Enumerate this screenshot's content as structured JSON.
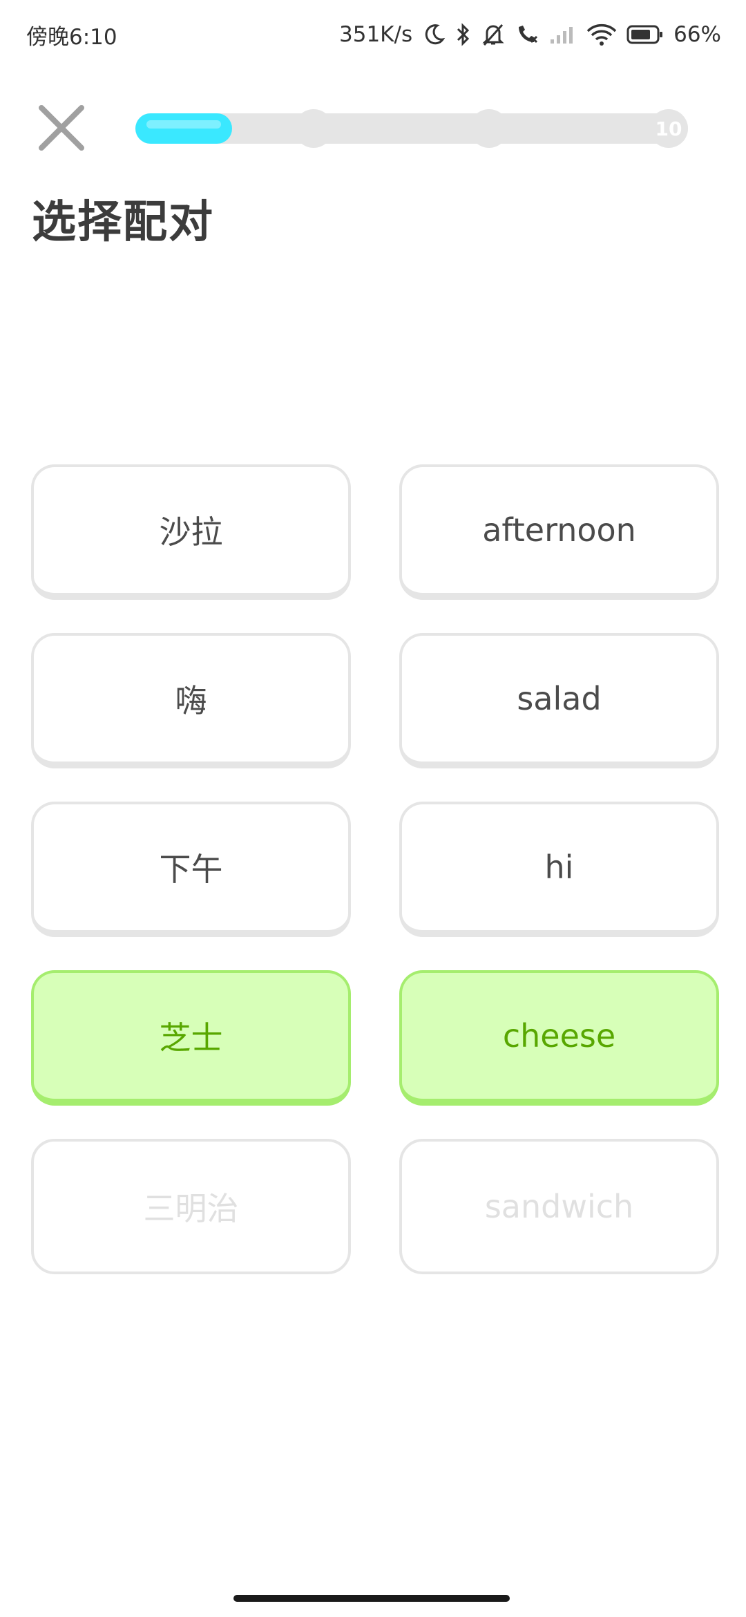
{
  "status_bar": {
    "time": "傍晚6:10",
    "net_speed": "351K/s",
    "battery": "66%",
    "icons": [
      "moon-icon",
      "bluetooth-icon",
      "mute-icon",
      "call-blocked-icon",
      "signal-icon",
      "wifi-icon",
      "battery-icon"
    ]
  },
  "header": {
    "close_icon": "close-icon",
    "progress": {
      "fraction": 0.175,
      "milestones": [
        "",
        "",
        "10"
      ]
    },
    "title": "选择配对"
  },
  "tiles": [
    {
      "left": "沙拉",
      "right": "afternoon"
    },
    {
      "left": "嗨",
      "right": "salad"
    },
    {
      "left": "下午",
      "right": "hi"
    },
    {
      "left": "芝士",
      "right": "cheese"
    },
    {
      "left": "三明治",
      "right": "sandwich"
    }
  ],
  "colors": {
    "progress_fill": "#3ae8ff",
    "matched_bg": "#d7ffb8",
    "matched_border": "#a5ed6e",
    "matched_text": "#58a700",
    "tile_border": "#e5e5e5"
  }
}
